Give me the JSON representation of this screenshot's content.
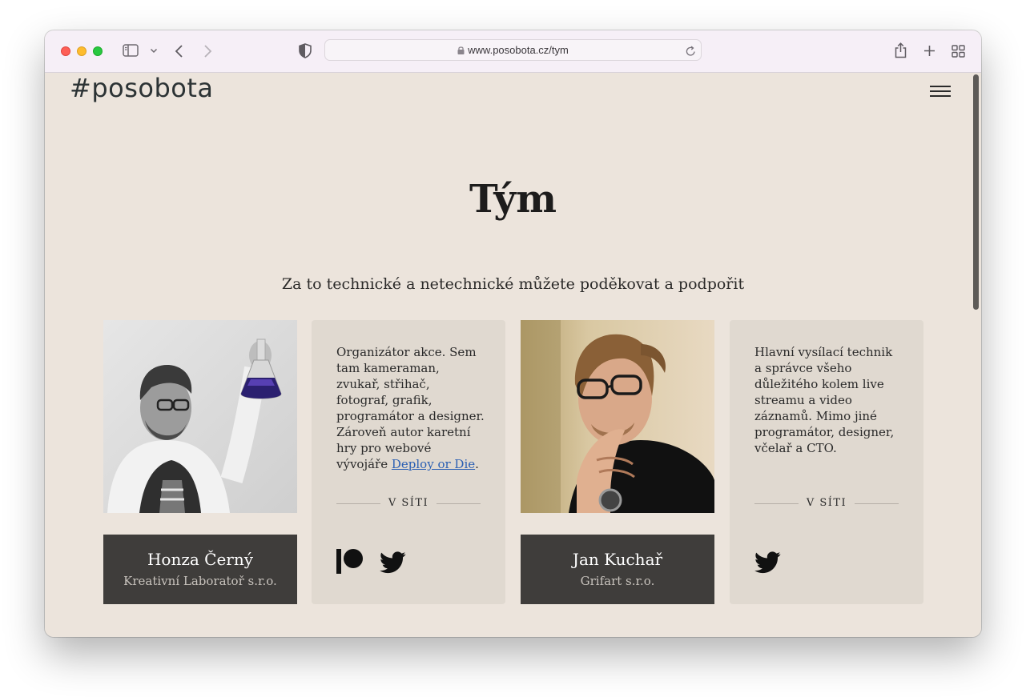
{
  "browser": {
    "url": "www.posobota.cz/tym"
  },
  "site": {
    "logo": "#posobota"
  },
  "page": {
    "title": "Tým",
    "subtitle": "Za to technické a netechnické můžete poděkovat a podpořit"
  },
  "team": [
    {
      "name": "Honza Černý",
      "company": "Kreativní Laboratoř s.r.o.",
      "bio_before": "Organizátor akce. Sem tam kameraman, zvukař, střihač, fotograf, grafik, programátor a designer. Zároveň autor karetní hry pro webové vývojáře ",
      "bio_link": "Deploy or Die",
      "bio_after": ".",
      "social_heading": "V SÍTI",
      "social": [
        "patreon-icon",
        "twitter-icon"
      ]
    },
    {
      "name": "Jan Kuchař",
      "company": "Grifart s.r.o.",
      "bio": "Hlavní vysílací technik a správce všeho důležitého kolem live streamu a video záznamů. Mimo jiné programátor, designer, včelař a CTO.",
      "social_heading": "V SÍTI",
      "social": [
        "twitter-icon"
      ]
    }
  ],
  "colors": {
    "page_bg": "#ece4dc",
    "card_bg": "#e0d9d0",
    "name_card_bg": "#3f3d3b",
    "link": "#2a5fb3"
  }
}
